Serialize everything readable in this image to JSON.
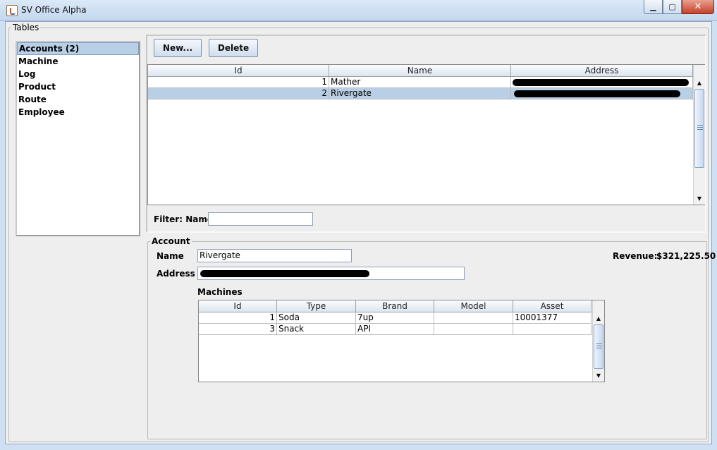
{
  "window": {
    "title": "SV Office Alpha",
    "controls": {
      "minimize": "▁",
      "maximize": "▢",
      "close": "✕"
    }
  },
  "tables_group": {
    "legend": "Tables",
    "items": [
      {
        "label": "Accounts (2)",
        "selected": true
      },
      {
        "label": "Machine"
      },
      {
        "label": "Log"
      },
      {
        "label": "Product"
      },
      {
        "label": "Route"
      },
      {
        "label": "Employee"
      }
    ]
  },
  "toolbar": {
    "new_label": "New...",
    "delete_label": "Delete"
  },
  "accounts_table": {
    "columns": [
      "Id",
      "Name",
      "Address"
    ],
    "rows": [
      {
        "id": "1",
        "name": "Mather",
        "address": ""
      },
      {
        "id": "2",
        "name": "Rivergate",
        "address": ""
      }
    ],
    "selected_row": 1
  },
  "filter": {
    "label": "Filter: Name",
    "value": ""
  },
  "account": {
    "legend": "Account",
    "name_label": "Name",
    "name_value": "Rivergate",
    "address_label": "Address",
    "address_value": "",
    "revenue_label": "Revenue:",
    "revenue_value": "$321,225.50",
    "machines_label": "Machines"
  },
  "machines_table": {
    "columns": [
      "Id",
      "Type",
      "Brand",
      "Model",
      "Asset"
    ],
    "rows": [
      {
        "id": "1",
        "type": "Soda",
        "brand": "7up",
        "model": "",
        "asset": "10001377"
      },
      {
        "id": "3",
        "type": "Snack",
        "brand": "API",
        "model": "",
        "asset": ""
      }
    ]
  },
  "scroll": {
    "up": "▲",
    "down": "▼"
  }
}
